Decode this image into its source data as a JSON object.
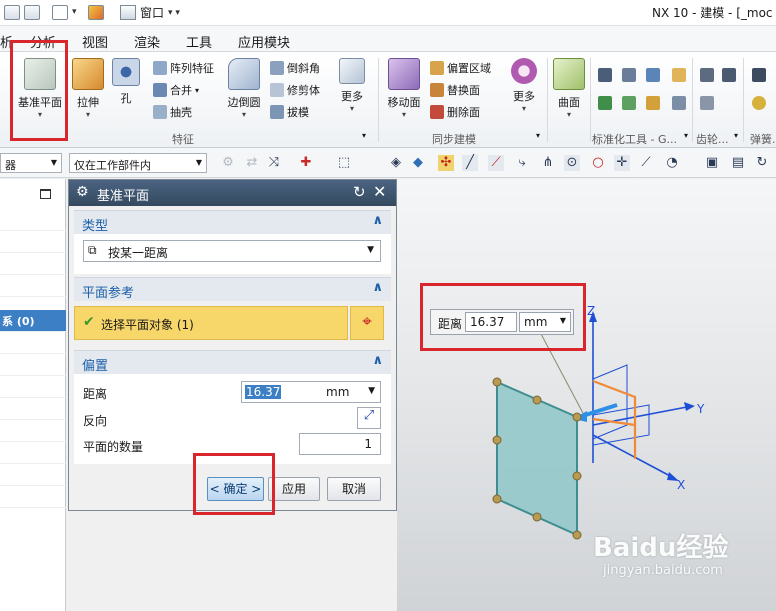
{
  "app_title": "NX 10 - 建模 - [_moc",
  "window_menu": {
    "label": "窗口"
  },
  "ribbon_tabs": [
    "析",
    "分析",
    "视图",
    "渲染",
    "工具",
    "应用模块"
  ],
  "ribbon": {
    "datum_plane": "基准平面",
    "extrude": "拉伸",
    "hole": "孔",
    "pattern_feature": "阵列特征",
    "unite": "合并",
    "shell": "抽壳",
    "edge_blend": "边倒圆",
    "chamfer": "倒斜角",
    "trim_body": "修剪体",
    "draft": "拔模",
    "more1": "更多",
    "feature_group": "特征",
    "move_face": "移动面",
    "offset_region": "偏置区域",
    "replace_face": "替换面",
    "delete_face": "删除面",
    "more2": "更多",
    "surface": "曲面",
    "sync_group": "同步建模",
    "std_tools_group": "标准化工具 - G...",
    "gear_group": "齿轮...",
    "spring_group": "弹簧..."
  },
  "toolbar": {
    "filter_combo": "器",
    "scope_combo": "仅在工作部件内"
  },
  "navigator": {
    "selected_item": "系 (0)"
  },
  "dialog": {
    "title": "基准平面",
    "type_section": "类型",
    "type_value": "按某一距离",
    "ref_section": "平面参考",
    "select_object": "选择平面对象 (1)",
    "offset_section": "偏置",
    "distance_label": "距离",
    "distance_value": "16.37",
    "distance_unit": "mm",
    "reverse_label": "反向",
    "count_label": "平面的数量",
    "count_value": "1",
    "ok_button": "< 确定 >",
    "apply_button": "应用",
    "cancel_button": "取消"
  },
  "float_input": {
    "label": "距离",
    "value": "16.37",
    "unit": "mm"
  },
  "axes": {
    "x": "X",
    "y": "Y",
    "z": "Z"
  },
  "watermark": {
    "logo": "Baidu经验",
    "url": "jingyan.baidu.com"
  },
  "colors": {
    "highlight_red": "#d9262c",
    "section_yellow": "#f7d66a",
    "header_blue": "#3d546f",
    "plane_teal": "#8fc7c9",
    "accent_blue": "#1d5fa8"
  }
}
